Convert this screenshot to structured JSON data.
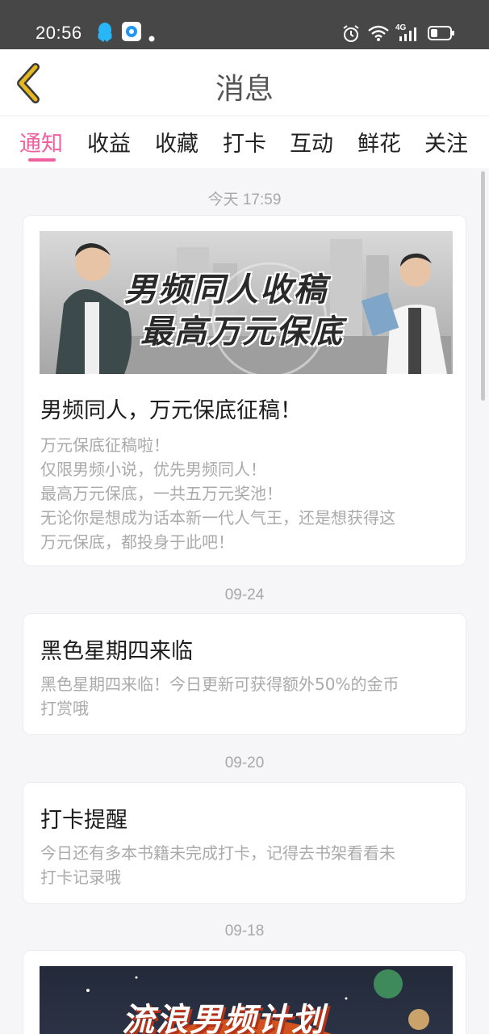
{
  "status_bar": {
    "time": "20:56",
    "network": "4G"
  },
  "header": {
    "title": "消息"
  },
  "tabs": [
    {
      "label": "通知",
      "active": true
    },
    {
      "label": "收益",
      "active": false
    },
    {
      "label": "收藏",
      "active": false
    },
    {
      "label": "打卡",
      "active": false
    },
    {
      "label": "互动",
      "active": false
    },
    {
      "label": "鲜花",
      "active": false
    },
    {
      "label": "关注",
      "active": false
    }
  ],
  "messages": [
    {
      "date": "今天 17:59",
      "banner_text": [
        "男频同人收稿",
        "最高万元保底"
      ],
      "title": "男频同人，万元保底征稿！",
      "body": [
        "万元保底征稿啦！",
        "仅限男频小说，优先男频同人！",
        "最高万元保底，一共五万元奖池！",
        "无论你是想成为话本新一代人气王，还是想获得这",
        "万元保底，都投身于此吧！"
      ]
    },
    {
      "date": "09-24",
      "title": "黑色星期四来临",
      "body": [
        "黑色星期四来临！今日更新可获得额外50%的金币",
        "打赏哦"
      ]
    },
    {
      "date": "09-20",
      "title": "打卡提醒",
      "body": [
        "今日还有多本书籍未完成打卡，记得去书架看看未",
        "打卡记录哦"
      ]
    },
    {
      "date": "09-18",
      "banner_text": [
        "流浪男频计划"
      ]
    }
  ],
  "colors": {
    "accent": "#f0609e",
    "status_bar": "#474747",
    "back_icon": "#e5b81f"
  }
}
